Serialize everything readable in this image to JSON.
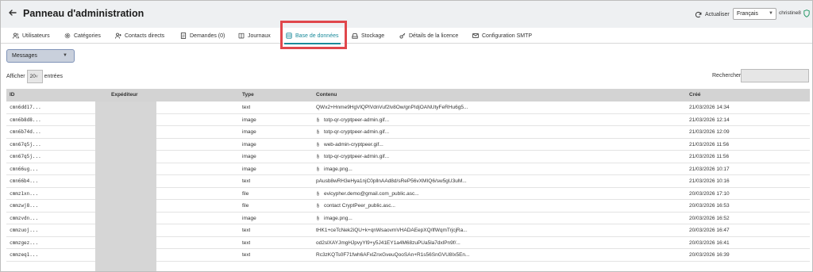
{
  "header": {
    "title": "Panneau d'administration",
    "refresh_label": "Actualiser",
    "language": "Français",
    "username": "christine8"
  },
  "tabs": [
    {
      "label": "Utilisateurs",
      "icon": "users-icon"
    },
    {
      "label": "Catégories",
      "icon": "gear-icon"
    },
    {
      "label": "Contacts directs",
      "icon": "user-plus-icon"
    },
    {
      "label": "Demandes (0)",
      "icon": "document-icon"
    },
    {
      "label": "Journaux",
      "icon": "book-icon"
    },
    {
      "label": "Base de données",
      "icon": "database-icon",
      "active": true
    },
    {
      "label": "Stockage",
      "icon": "drive-icon"
    },
    {
      "label": "Détails de la licence",
      "icon": "key-icon"
    },
    {
      "label": "Configuration SMTP",
      "icon": "mail-icon"
    }
  ],
  "table_select": {
    "value": "Messages"
  },
  "length": {
    "prefix": "Afficher",
    "value": "20",
    "suffix": "entrées"
  },
  "search": {
    "label": "Rechercher:"
  },
  "columns": [
    "ID",
    "Expéditeur",
    "Type",
    "Contenu",
    "Créé"
  ],
  "rows": [
    {
      "id": "cmn6dd17...",
      "type": "text",
      "content": "QWx2+Hnme9HgVlQPlVdnVuf2lv8Ow/gnPIdjOANUtyFeRHu6g5...",
      "attachment": false,
      "created": "21/03/2026 14:34"
    },
    {
      "id": "cmn6b8d8...",
      "type": "image",
      "content": "totp-qr-cryptpeer-admin.gif...",
      "attachment": true,
      "created": "21/03/2026 12:14"
    },
    {
      "id": "cmn6b74d...",
      "type": "image",
      "content": "totp-qr-cryptpeer-admin.gif...",
      "attachment": true,
      "created": "21/03/2026 12:09"
    },
    {
      "id": "cmn67q5j...",
      "type": "image",
      "content": "web-admin-cryptpeer.gif...",
      "attachment": true,
      "created": "21/03/2026 11:56"
    },
    {
      "id": "cmn67q5j...",
      "type": "image",
      "content": "totp-qr-cryptpeer-admin.gif...",
      "attachment": true,
      "created": "21/03/2026 11:56"
    },
    {
      "id": "cmn66ug...",
      "type": "image",
      "content": "image.png...",
      "attachment": true,
      "created": "21/03/2026 10:17"
    },
    {
      "id": "cmn66b4...",
      "type": "text",
      "content": "pAusb8wRH3eHya1njC0pllnAAd8d/sReP56vXMIQ6/sw5gU3uM...",
      "attachment": false,
      "created": "21/03/2026 10:16"
    },
    {
      "id": "cmmz1xn...",
      "type": "file",
      "content": "evicypher.demo@gmail.com_public.asc...",
      "attachment": true,
      "created": "20/03/2026 17:10"
    },
    {
      "id": "cmmzwj8...",
      "type": "file",
      "content": "contact CryptPeer_public.asc...",
      "attachment": true,
      "created": "20/03/2026 16:53"
    },
    {
      "id": "cmmzvdn...",
      "type": "image",
      "content": "image.png...",
      "attachment": true,
      "created": "20/03/2026 16:52"
    },
    {
      "id": "cmmzuoj...",
      "type": "text",
      "content": "tHK1+ceTcNek2iQU+k+qnWsaovmVHADAEepXQ/lfWqmTrjcjRa...",
      "attachment": false,
      "created": "20/03/2026 16:47"
    },
    {
      "id": "cmmzgez...",
      "type": "text",
      "content": "od2slXAYJmgHJpvyYl9+y5J41EY1a4M68zuPUa5la7dxlPn9f/...",
      "attachment": false,
      "created": "20/03/2026 16:41"
    },
    {
      "id": "cmmzeq1...",
      "type": "text",
      "content": "Rc3zKQTs0F71fwh6AFxlZnxGveuQooSAn+R1s56SnGVU8Ix5En...",
      "attachment": false,
      "created": "20/03/2026 16:39"
    }
  ]
}
